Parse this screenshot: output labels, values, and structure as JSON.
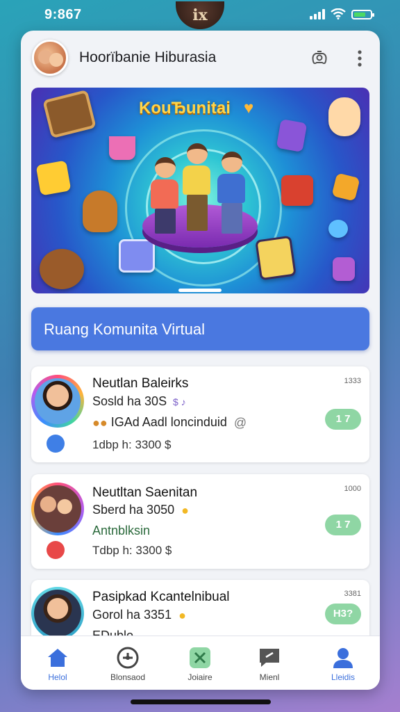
{
  "status_bar": {
    "time": "9:867",
    "notch_label": "ix"
  },
  "header": {
    "title": "Hoorïbanie Hiburasia"
  },
  "banner": {
    "title": "KouЂunitai"
  },
  "community_button": {
    "label": "Ruang Komunita Virtual"
  },
  "cards": [
    {
      "name": "Neutlan Baleirks",
      "status": "Sosld ha 30S",
      "line3": "IGAd Aadl loncinduid",
      "line4": "1dbp h: 3300 $",
      "time": "1333",
      "badge": "1 7",
      "dot_color": "#3f7fe6"
    },
    {
      "name": "Neutltan Saenitan",
      "status": "Sberd ha 3050",
      "line3": "Antnblksin",
      "line4": "Tdbp h: 3300 $",
      "time": "1000",
      "badge": "1 7",
      "dot_color": "#e84848"
    },
    {
      "name": "Pasipkad Kcantelnibual",
      "status": "Gorol ha 3351",
      "line3": "EDublo",
      "line4": "",
      "time": "3381",
      "badge": "H3?",
      "dot_color": ""
    }
  ],
  "nav": [
    {
      "label": "Helol",
      "icon": "home-icon",
      "color": "#3b6fdc"
    },
    {
      "label": "Blonsaod",
      "icon": "compass-icon",
      "color": "#444"
    },
    {
      "label": "Joiaire",
      "icon": "game-icon",
      "color": "#444"
    },
    {
      "label": "Mienl",
      "icon": "message-icon",
      "color": "#444"
    },
    {
      "label": "Lleidis",
      "icon": "profile-icon",
      "color": "#3b6fdc"
    }
  ],
  "colors": {
    "accent": "#4a78e0",
    "badge": "#8fd6a4"
  }
}
